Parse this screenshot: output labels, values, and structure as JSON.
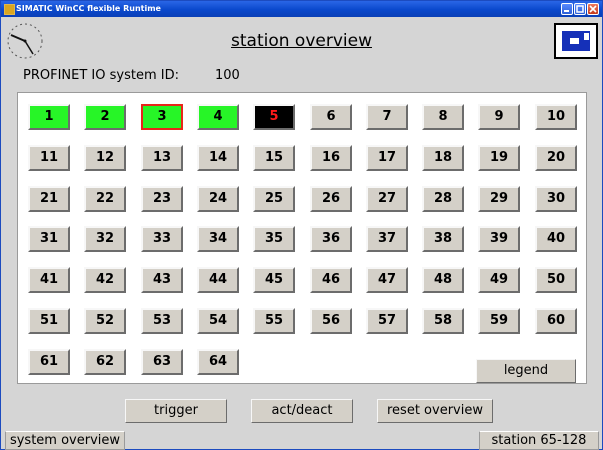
{
  "window": {
    "title": "SIMATIC WinCC flexible Runtime"
  },
  "header": {
    "title": "station overview"
  },
  "profinet": {
    "label": "PROFINET IO system ID:",
    "value": "100"
  },
  "stations": [
    {
      "label": "1",
      "state": "ok"
    },
    {
      "label": "2",
      "state": "ok"
    },
    {
      "label": "3",
      "state": "ok-selected"
    },
    {
      "label": "4",
      "state": "ok"
    },
    {
      "label": "5",
      "state": "fault"
    },
    {
      "label": "6",
      "state": "normal"
    },
    {
      "label": "7",
      "state": "normal"
    },
    {
      "label": "8",
      "state": "normal"
    },
    {
      "label": "9",
      "state": "normal"
    },
    {
      "label": "10",
      "state": "normal"
    },
    {
      "label": "11",
      "state": "normal"
    },
    {
      "label": "12",
      "state": "normal"
    },
    {
      "label": "13",
      "state": "normal"
    },
    {
      "label": "14",
      "state": "normal"
    },
    {
      "label": "15",
      "state": "normal"
    },
    {
      "label": "16",
      "state": "normal"
    },
    {
      "label": "17",
      "state": "normal"
    },
    {
      "label": "18",
      "state": "normal"
    },
    {
      "label": "19",
      "state": "normal"
    },
    {
      "label": "20",
      "state": "normal"
    },
    {
      "label": "21",
      "state": "normal"
    },
    {
      "label": "22",
      "state": "normal"
    },
    {
      "label": "23",
      "state": "normal"
    },
    {
      "label": "24",
      "state": "normal"
    },
    {
      "label": "25",
      "state": "normal"
    },
    {
      "label": "26",
      "state": "normal"
    },
    {
      "label": "27",
      "state": "normal"
    },
    {
      "label": "28",
      "state": "normal"
    },
    {
      "label": "29",
      "state": "normal"
    },
    {
      "label": "30",
      "state": "normal"
    },
    {
      "label": "31",
      "state": "normal"
    },
    {
      "label": "32",
      "state": "normal"
    },
    {
      "label": "33",
      "state": "normal"
    },
    {
      "label": "34",
      "state": "normal"
    },
    {
      "label": "35",
      "state": "normal"
    },
    {
      "label": "36",
      "state": "normal"
    },
    {
      "label": "37",
      "state": "normal"
    },
    {
      "label": "38",
      "state": "normal"
    },
    {
      "label": "39",
      "state": "normal"
    },
    {
      "label": "40",
      "state": "normal"
    },
    {
      "label": "41",
      "state": "normal"
    },
    {
      "label": "42",
      "state": "normal"
    },
    {
      "label": "43",
      "state": "normal"
    },
    {
      "label": "44",
      "state": "normal"
    },
    {
      "label": "45",
      "state": "normal"
    },
    {
      "label": "46",
      "state": "normal"
    },
    {
      "label": "47",
      "state": "normal"
    },
    {
      "label": "48",
      "state": "normal"
    },
    {
      "label": "49",
      "state": "normal"
    },
    {
      "label": "50",
      "state": "normal"
    },
    {
      "label": "51",
      "state": "normal"
    },
    {
      "label": "52",
      "state": "normal"
    },
    {
      "label": "53",
      "state": "normal"
    },
    {
      "label": "54",
      "state": "normal"
    },
    {
      "label": "55",
      "state": "normal"
    },
    {
      "label": "56",
      "state": "normal"
    },
    {
      "label": "57",
      "state": "normal"
    },
    {
      "label": "58",
      "state": "normal"
    },
    {
      "label": "59",
      "state": "normal"
    },
    {
      "label": "60",
      "state": "normal"
    },
    {
      "label": "61",
      "state": "normal"
    },
    {
      "label": "62",
      "state": "normal"
    },
    {
      "label": "63",
      "state": "normal"
    },
    {
      "label": "64",
      "state": "normal"
    }
  ],
  "colors": {
    "ok": "#27f527",
    "fault_bg": "#000000",
    "fault_text": "#ff1a1a",
    "selected_border": "#e8261a",
    "normal": "#d4d0c8"
  },
  "legend": {
    "label": "legend"
  },
  "actions": {
    "trigger": "trigger",
    "act_deact": "act/deact",
    "reset": "reset overview"
  },
  "footer": {
    "left_tab": "system overview",
    "right_tab": "station 65-128"
  },
  "icons": {
    "clock": "clock-icon",
    "flag": "flag-icon"
  }
}
